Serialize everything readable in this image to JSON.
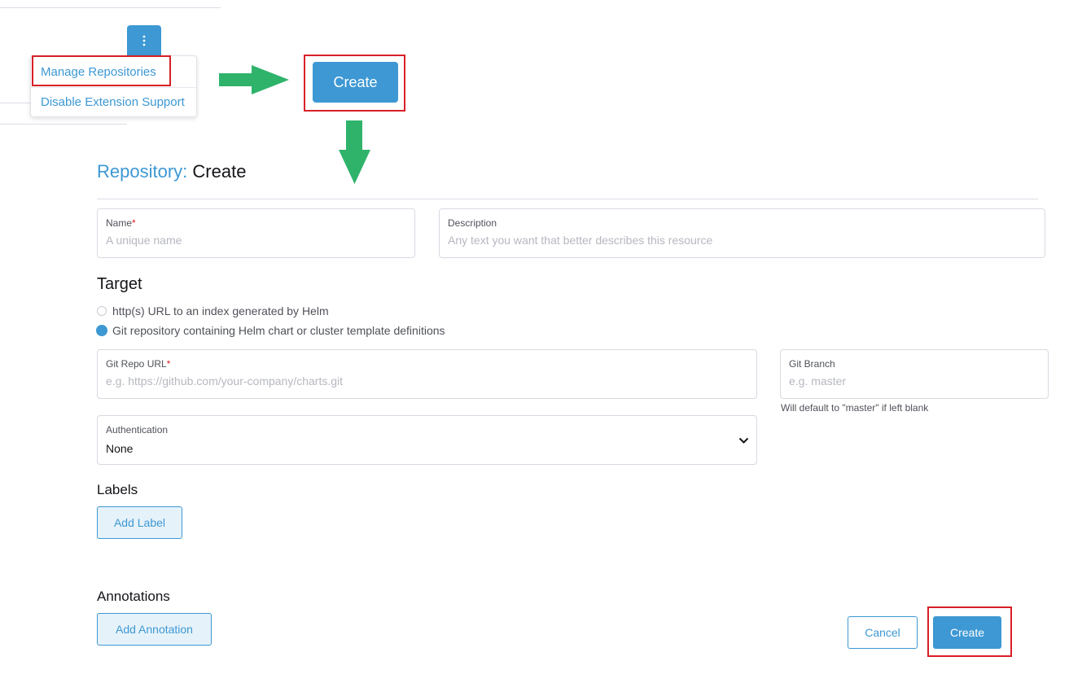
{
  "menu": {
    "kebab_icon": "vertical-dots-icon",
    "items": [
      {
        "label": "Manage Repositories"
      },
      {
        "label": "Disable Extension Support"
      }
    ]
  },
  "list_header": {
    "create_label": "Create"
  },
  "page": {
    "title_prefix": "Repository:",
    "title_action": "Create"
  },
  "form": {
    "name": {
      "label": "Name",
      "required_mark": "*",
      "placeholder": "A unique name"
    },
    "description": {
      "label": "Description",
      "placeholder": "Any text you want that better describes this resource"
    },
    "target": {
      "heading": "Target",
      "options": [
        {
          "label": "http(s) URL to an index generated by Helm",
          "selected": false
        },
        {
          "label": "Git repository containing Helm chart or cluster template definitions",
          "selected": true
        }
      ]
    },
    "git_repo_url": {
      "label": "Git Repo URL",
      "required_mark": "*",
      "placeholder": "e.g. https://github.com/your-company/charts.git"
    },
    "git_branch": {
      "label": "Git Branch",
      "placeholder": "e.g. master",
      "hint": "Will default to \"master\" if left blank"
    },
    "authentication": {
      "label": "Authentication",
      "value": "None"
    },
    "labels": {
      "heading": "Labels",
      "add_label": "Add Label"
    },
    "annotations": {
      "heading": "Annotations",
      "add_label": "Add Annotation"
    }
  },
  "footer": {
    "cancel_label": "Cancel",
    "create_label": "Create"
  },
  "colors": {
    "accent": "#3d98d3",
    "highlight": "#d81f26",
    "arrow": "#2fb36b"
  }
}
